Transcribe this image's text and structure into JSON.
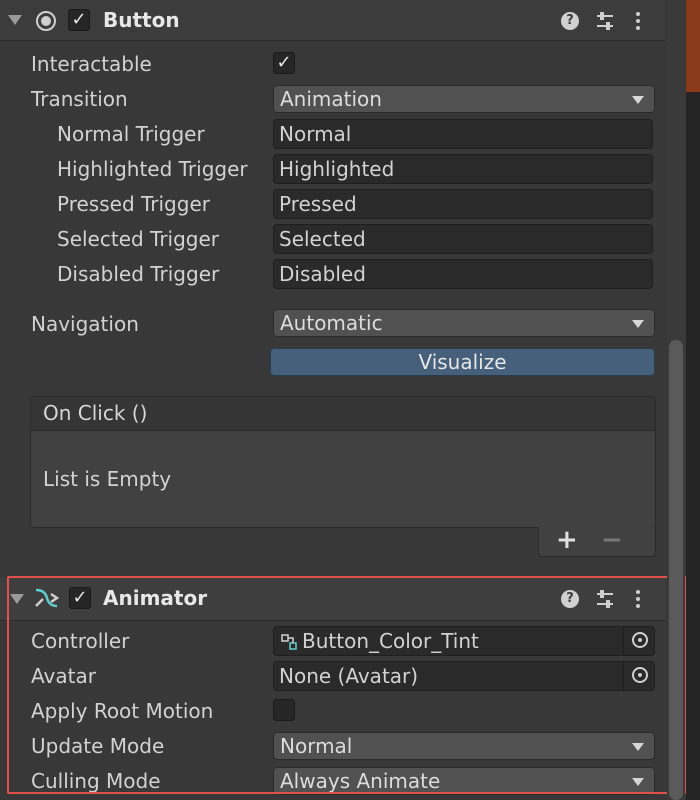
{
  "button_component": {
    "title": "Button",
    "enabled": true,
    "help_icon": "help-icon",
    "presets_icon": "sliders-icon",
    "menu_icon": "kebab-menu-icon",
    "fields": {
      "interactable_label": "Interactable",
      "interactable_checked": true,
      "transition_label": "Transition",
      "transition_value": "Animation",
      "normal_trigger_label": "Normal Trigger",
      "normal_trigger_value": "Normal",
      "highlighted_trigger_label": "Highlighted Trigger",
      "highlighted_trigger_value": "Highlighted",
      "pressed_trigger_label": "Pressed Trigger",
      "pressed_trigger_value": "Pressed",
      "selected_trigger_label": "Selected Trigger",
      "selected_trigger_value": "Selected",
      "disabled_trigger_label": "Disabled Trigger",
      "disabled_trigger_value": "Disabled",
      "navigation_label": "Navigation",
      "navigation_value": "Automatic",
      "visualize_label": "Visualize"
    },
    "on_click": {
      "header": "On Click ()",
      "empty_text": "List is Empty",
      "add_label": "+",
      "remove_label": "−"
    }
  },
  "animator_component": {
    "title": "Animator",
    "enabled": true,
    "fields": {
      "controller_label": "Controller",
      "controller_value": "Button_Color_Tint",
      "avatar_label": "Avatar",
      "avatar_value": "None (Avatar)",
      "apply_root_motion_label": "Apply Root Motion",
      "apply_root_motion_checked": false,
      "update_mode_label": "Update Mode",
      "update_mode_value": "Normal",
      "culling_mode_label": "Culling Mode",
      "culling_mode_value": "Always Animate"
    }
  },
  "colors": {
    "background": "#383838",
    "visualize_button": "#46607c",
    "highlight_border": "#e0504c"
  }
}
